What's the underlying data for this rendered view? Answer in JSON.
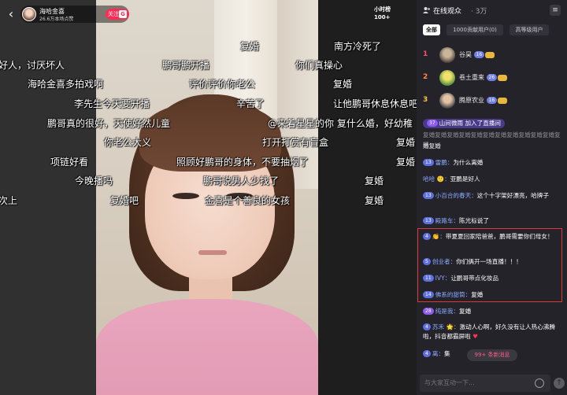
{
  "streamer": {
    "name": "海哈金喜",
    "fans": "26.6万本场点赞",
    "follow_label": "关注",
    "follow_badge": "G"
  },
  "hour_rank": {
    "title": "小时榜",
    "value": "100+"
  },
  "danmaku": [
    "复婚",
    "南方冷死了",
    "好人，讨厌坏人",
    "鹏哥鹏开播",
    "你们真操心",
    "海哈金喜多拍戏啊",
    "评价评价你老公",
    "复婚",
    "李先生今天要开播",
    "辛苦了",
    "让他鹏哥休息休息吧",
    "鹏哥真的很好，天使好然儿童",
    "@来着星星的你 复什么婚，好幼稚",
    "你老公大义",
    "打开打赏有盲盒",
    "复婚",
    "项链好看",
    "照顾好鹏哥的身体，不要抽烟了",
    "复婚",
    "今晚播吗",
    "鹏哥说男人少找了",
    "复婚",
    "次上",
    "复婚吧",
    "金喜是个善良的女孩",
    "复婚"
  ],
  "panel": {
    "title": "在线观众",
    "count": "· 3万",
    "tabs": [
      "全部",
      "1000贡献用户(0)",
      "高等级用户"
    ],
    "ranking": [
      {
        "rank": "1",
        "name": "谷昊",
        "level": "16"
      },
      {
        "rank": "2",
        "name": "卷土重来",
        "level": "26"
      },
      {
        "rank": "3",
        "name": "腾原农业",
        "level": "16"
      }
    ],
    "chat": [
      {
        "badge": "37",
        "user": "山间微雨",
        "text": "加入了直播间",
        "kind": "join"
      },
      {
        "text": "复婚复婚复婚复婚复婚复婚复婚复婚复婚复婚复婚复婚",
        "kind": "scroll"
      },
      {
        "text": "婚复婚",
        "kind": "plain"
      },
      {
        "badge": "13",
        "user": "雷鹏",
        "text": "为什么离婚"
      },
      {
        "badge": "",
        "user": "哈哈",
        "text": "亚鹏是好人"
      },
      {
        "badge": "13",
        "user": "小百合的春天",
        "text": "这个十字架好漂亮，哈牌子"
      },
      {
        "badge": "13",
        "user": "殿路车",
        "text": "陈光标说了"
      },
      {
        "badge": "4",
        "user": "",
        "text": "带夏夏回家陪爸爸，鹏哥需要你们母女！"
      },
      {
        "badge": "5",
        "user": "创业者",
        "text": "你们俩开一场直播！！！"
      },
      {
        "badge": "11",
        "user": "IVY",
        "text": "让鹏哥带点化妆品"
      },
      {
        "badge": "14",
        "user": "佛系的甜筒",
        "text": "复婚"
      },
      {
        "badge": "28",
        "user": "纯是我",
        "text": "复婚"
      },
      {
        "badge": "4",
        "user": "苏禾",
        "text": "激动人心啊，好久没有让人热心沸腾啦，抖音都霸屏啦"
      },
      {
        "badge": "4",
        "user": "离",
        "text": "集"
      }
    ],
    "new_messages": "99+ 条新消息",
    "input_placeholder": "与大家互动一下..."
  },
  "colors": {
    "accent": "#fe2c55",
    "highlight_border": "#e0383a",
    "panel_bg": "#242329",
    "level_badge": "#5e6fe0"
  }
}
